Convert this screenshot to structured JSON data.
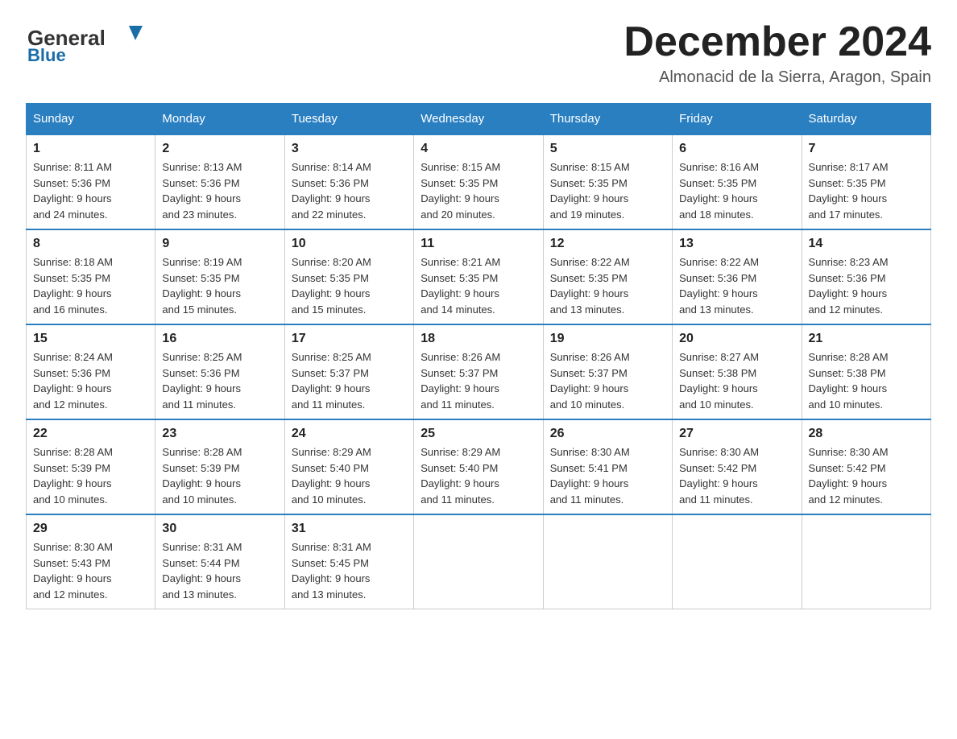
{
  "header": {
    "title": "December 2024",
    "location": "Almonacid de la Sierra, Aragon, Spain",
    "logo_general": "General",
    "logo_blue": "Blue"
  },
  "weekdays": [
    "Sunday",
    "Monday",
    "Tuesday",
    "Wednesday",
    "Thursday",
    "Friday",
    "Saturday"
  ],
  "weeks": [
    [
      {
        "day": "1",
        "sunrise": "8:11 AM",
        "sunset": "5:36 PM",
        "daylight": "9 hours and 24 minutes."
      },
      {
        "day": "2",
        "sunrise": "8:13 AM",
        "sunset": "5:36 PM",
        "daylight": "9 hours and 23 minutes."
      },
      {
        "day": "3",
        "sunrise": "8:14 AM",
        "sunset": "5:36 PM",
        "daylight": "9 hours and 22 minutes."
      },
      {
        "day": "4",
        "sunrise": "8:15 AM",
        "sunset": "5:35 PM",
        "daylight": "9 hours and 20 minutes."
      },
      {
        "day": "5",
        "sunrise": "8:15 AM",
        "sunset": "5:35 PM",
        "daylight": "9 hours and 19 minutes."
      },
      {
        "day": "6",
        "sunrise": "8:16 AM",
        "sunset": "5:35 PM",
        "daylight": "9 hours and 18 minutes."
      },
      {
        "day": "7",
        "sunrise": "8:17 AM",
        "sunset": "5:35 PM",
        "daylight": "9 hours and 17 minutes."
      }
    ],
    [
      {
        "day": "8",
        "sunrise": "8:18 AM",
        "sunset": "5:35 PM",
        "daylight": "9 hours and 16 minutes."
      },
      {
        "day": "9",
        "sunrise": "8:19 AM",
        "sunset": "5:35 PM",
        "daylight": "9 hours and 15 minutes."
      },
      {
        "day": "10",
        "sunrise": "8:20 AM",
        "sunset": "5:35 PM",
        "daylight": "9 hours and 15 minutes."
      },
      {
        "day": "11",
        "sunrise": "8:21 AM",
        "sunset": "5:35 PM",
        "daylight": "9 hours and 14 minutes."
      },
      {
        "day": "12",
        "sunrise": "8:22 AM",
        "sunset": "5:35 PM",
        "daylight": "9 hours and 13 minutes."
      },
      {
        "day": "13",
        "sunrise": "8:22 AM",
        "sunset": "5:36 PM",
        "daylight": "9 hours and 13 minutes."
      },
      {
        "day": "14",
        "sunrise": "8:23 AM",
        "sunset": "5:36 PM",
        "daylight": "9 hours and 12 minutes."
      }
    ],
    [
      {
        "day": "15",
        "sunrise": "8:24 AM",
        "sunset": "5:36 PM",
        "daylight": "9 hours and 12 minutes."
      },
      {
        "day": "16",
        "sunrise": "8:25 AM",
        "sunset": "5:36 PM",
        "daylight": "9 hours and 11 minutes."
      },
      {
        "day": "17",
        "sunrise": "8:25 AM",
        "sunset": "5:37 PM",
        "daylight": "9 hours and 11 minutes."
      },
      {
        "day": "18",
        "sunrise": "8:26 AM",
        "sunset": "5:37 PM",
        "daylight": "9 hours and 11 minutes."
      },
      {
        "day": "19",
        "sunrise": "8:26 AM",
        "sunset": "5:37 PM",
        "daylight": "9 hours and 10 minutes."
      },
      {
        "day": "20",
        "sunrise": "8:27 AM",
        "sunset": "5:38 PM",
        "daylight": "9 hours and 10 minutes."
      },
      {
        "day": "21",
        "sunrise": "8:28 AM",
        "sunset": "5:38 PM",
        "daylight": "9 hours and 10 minutes."
      }
    ],
    [
      {
        "day": "22",
        "sunrise": "8:28 AM",
        "sunset": "5:39 PM",
        "daylight": "9 hours and 10 minutes."
      },
      {
        "day": "23",
        "sunrise": "8:28 AM",
        "sunset": "5:39 PM",
        "daylight": "9 hours and 10 minutes."
      },
      {
        "day": "24",
        "sunrise": "8:29 AM",
        "sunset": "5:40 PM",
        "daylight": "9 hours and 10 minutes."
      },
      {
        "day": "25",
        "sunrise": "8:29 AM",
        "sunset": "5:40 PM",
        "daylight": "9 hours and 11 minutes."
      },
      {
        "day": "26",
        "sunrise": "8:30 AM",
        "sunset": "5:41 PM",
        "daylight": "9 hours and 11 minutes."
      },
      {
        "day": "27",
        "sunrise": "8:30 AM",
        "sunset": "5:42 PM",
        "daylight": "9 hours and 11 minutes."
      },
      {
        "day": "28",
        "sunrise": "8:30 AM",
        "sunset": "5:42 PM",
        "daylight": "9 hours and 12 minutes."
      }
    ],
    [
      {
        "day": "29",
        "sunrise": "8:30 AM",
        "sunset": "5:43 PM",
        "daylight": "9 hours and 12 minutes."
      },
      {
        "day": "30",
        "sunrise": "8:31 AM",
        "sunset": "5:44 PM",
        "daylight": "9 hours and 13 minutes."
      },
      {
        "day": "31",
        "sunrise": "8:31 AM",
        "sunset": "5:45 PM",
        "daylight": "9 hours and 13 minutes."
      },
      null,
      null,
      null,
      null
    ]
  ],
  "labels": {
    "sunrise_prefix": "Sunrise: ",
    "sunset_prefix": "Sunset: ",
    "daylight_prefix": "Daylight: "
  }
}
